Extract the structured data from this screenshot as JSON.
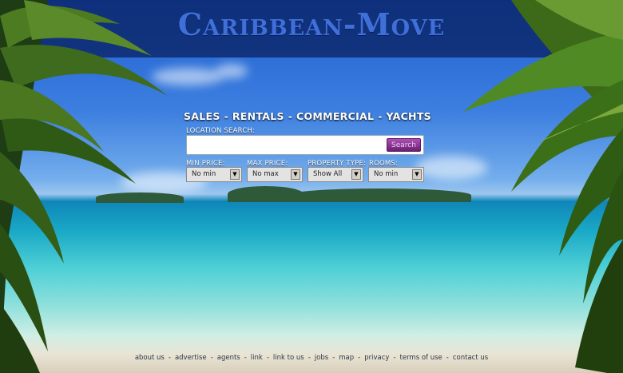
{
  "brand": {
    "logo": "Caribbean-Move"
  },
  "nav": {
    "items": [
      "SALES",
      "RENTALS",
      "COMMERCIAL",
      "YACHTS"
    ],
    "separator": "-"
  },
  "search": {
    "label": "LOCATION SEARCH:",
    "value": "",
    "button": "Search"
  },
  "filters": {
    "min_price": {
      "label": "MIN PRICE:",
      "value": "No min"
    },
    "max_price": {
      "label": "MAX PRICE:",
      "value": "No max"
    },
    "property_type": {
      "label": "PROPERTY TYPE:",
      "value": "Show All"
    },
    "rooms": {
      "label": "ROOMS:",
      "value": "No min"
    }
  },
  "footer": {
    "links": [
      "about us",
      "advertise",
      "agents",
      "link",
      "link to us",
      "jobs",
      "map",
      "privacy",
      "terms of use",
      "contact us"
    ],
    "separator": "-"
  },
  "colors": {
    "header_bg": "#0a2364",
    "logo": "#3f6fd9",
    "search_button": "#8a2f93"
  }
}
